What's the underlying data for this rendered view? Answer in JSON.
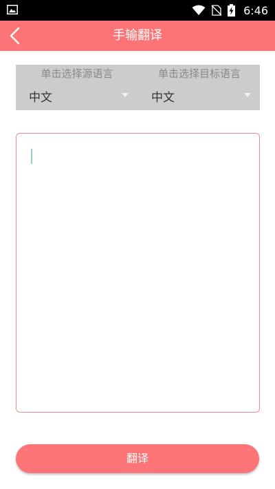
{
  "status_bar": {
    "time": "6:46",
    "icons": [
      "image-notification-icon",
      "wifi-icon",
      "no-sim-icon",
      "battery-charging-icon"
    ]
  },
  "app_bar": {
    "title": "手输翻译",
    "background_color": "#fc7475"
  },
  "language_selector": {
    "source": {
      "hint": "单击选择源语言",
      "value": "中文"
    },
    "target": {
      "hint": "单击选择目标语言",
      "value": "中文"
    },
    "panel_color": "#cccccc"
  },
  "input": {
    "value": "",
    "border_color": "#f08a8a"
  },
  "translate_button": {
    "label": "翻译",
    "color": "#fc7475"
  }
}
